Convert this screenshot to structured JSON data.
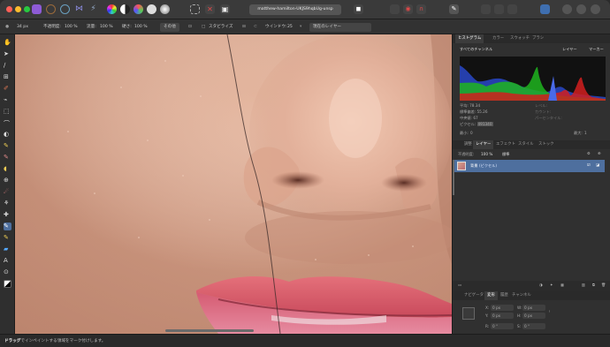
{
  "window": {
    "document_tab": "matthew-hamilton-UKJS9hqbUg-unsp"
  },
  "context_toolbar": {
    "brush_size": "34 px",
    "opacity_label": "不透明度:",
    "opacity_value": "100 %",
    "flow_label": "流量:",
    "flow_value": "100 %",
    "hardness_label": "硬さ:",
    "hardness_value": "100 %",
    "more_button": "その他",
    "stabilize_label": "スタビライズ",
    "window_label": "ウインドウ:",
    "window_value": "25",
    "source_select": "現在のレイヤー"
  },
  "histogram_panel": {
    "tabs": [
      "ヒストグラム",
      "カラー",
      "スウォッチ",
      "ブラシ"
    ],
    "channel_select": "すべてのチャンネル",
    "layer_button": "レイヤー",
    "marker_button": "マーカー",
    "stats": {
      "mean_label": "平均:",
      "mean_value": "78.34",
      "stddev_label": "標準偏差:",
      "stddev_value": "55.26",
      "median_label": "中央値:",
      "median_value": "67",
      "pixels_label": "ピクセル:",
      "pixels_value": "491340",
      "level_label": "レベル:",
      "count_label": "カウント:",
      "percentile_label": "パーセンタイル:"
    },
    "min_label": "最小:",
    "min_value": "0",
    "max_label": "最大:",
    "max_value": "1"
  },
  "layers_panel": {
    "tabs": [
      "調整",
      "レイヤー",
      "エフェクト",
      "スタイル",
      "ストック"
    ],
    "opacity_label": "不透明度:",
    "opacity_value": "100 %",
    "blend_mode": "標準",
    "layer_name": "背景",
    "layer_type": "(ピクセル)"
  },
  "transform_panel": {
    "tabs": [
      "ナビゲータ",
      "変形",
      "履歴",
      "チャンネル"
    ],
    "x_label": "X:",
    "x_value": "0 px",
    "y_label": "Y:",
    "y_value": "0 px",
    "w_label": "W:",
    "w_value": "0 px",
    "h_label": "H:",
    "h_value": "0 px",
    "r_label": "R:",
    "r_value": "0 °",
    "s_label": "S:",
    "s_value": "0 °"
  },
  "status_bar": {
    "bold": "ドラッグ",
    "text": "でインペイントする領域をマーク付けします。"
  },
  "colors": {
    "accent": "#4e6f9e",
    "panel": "#303030",
    "toolbar": "#323232"
  }
}
